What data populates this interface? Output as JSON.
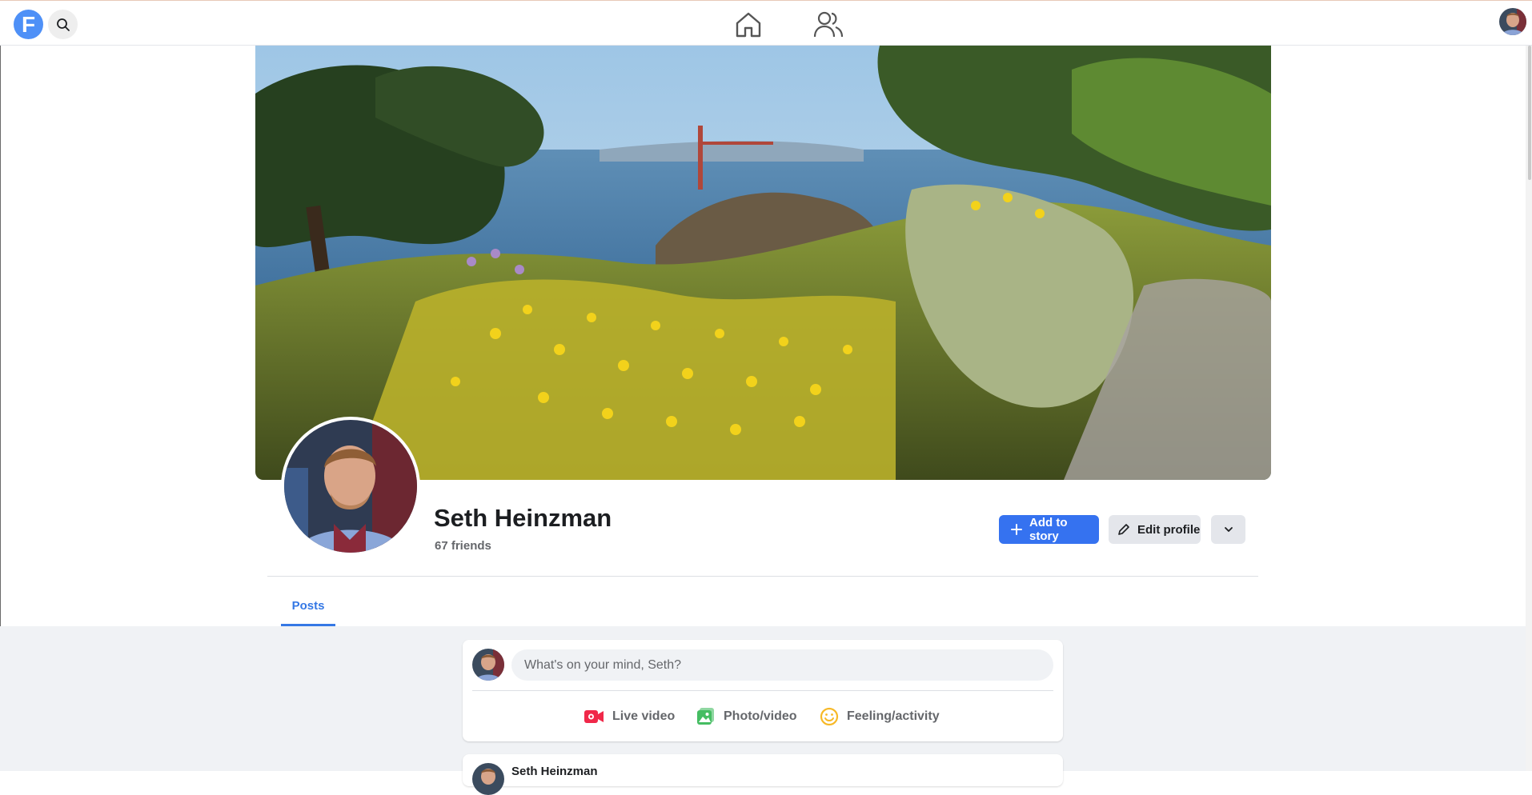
{
  "app": {
    "logo_letter": "F"
  },
  "nav": {
    "icons": [
      "search-icon",
      "home-icon",
      "friends-icon"
    ]
  },
  "profile": {
    "name": "Seth Heinzman",
    "friends": "67 friends",
    "add_story_label": "Add to story",
    "edit_profile_label": "Edit profile"
  },
  "tabs": [
    {
      "label": "Posts",
      "active": true
    }
  ],
  "composer": {
    "placeholder": "What's on your mind, Seth?",
    "actions": [
      {
        "label": "Live video",
        "icon": "live-video-icon",
        "color": "#f02849"
      },
      {
        "label": "Photo/video",
        "icon": "photo-icon",
        "color": "#45bd62"
      },
      {
        "label": "Feeling/activity",
        "icon": "feeling-icon",
        "color": "#f7b928"
      }
    ]
  },
  "post": {
    "author": "Seth Heinzman"
  },
  "colors": {
    "accent": "#3572f0",
    "tab_active": "#3578e5"
  }
}
